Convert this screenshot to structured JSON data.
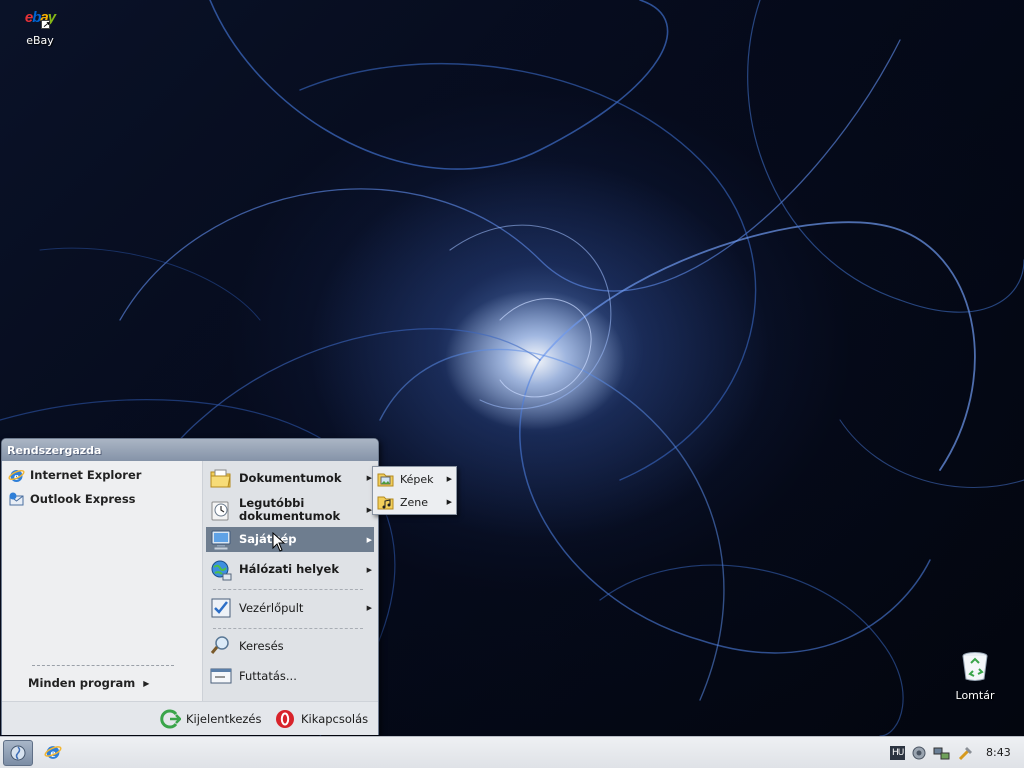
{
  "desktop": {
    "icons": [
      {
        "label": "eBay",
        "icon": "ebay-icon"
      },
      {
        "label": "Lomtár",
        "icon": "recycle-bin-icon"
      }
    ],
    "ebay_letters": [
      "e",
      "b",
      "a",
      "y"
    ]
  },
  "start_menu": {
    "user_name": "Rendszergazda",
    "pinned": [
      {
        "label": "Internet Explorer",
        "icon": "internet-explorer-icon"
      },
      {
        "label": "Outlook Express",
        "icon": "outlook-express-icon"
      }
    ],
    "all_programs_label": "Minden program",
    "right_items": [
      {
        "label": "Dokumentumok",
        "icon": "folder-documents-icon",
        "has_submenu": true
      },
      {
        "label": "Legutóbbi dokumentumok",
        "icon": "recent-documents-icon",
        "has_submenu": true
      },
      {
        "label": "Sajátgép",
        "icon": "my-computer-icon",
        "has_submenu": true,
        "highlighted": true
      },
      {
        "label": "Hálózati helyek",
        "icon": "network-places-icon",
        "has_submenu": true
      },
      {
        "label": "Vezérlőpult",
        "icon": "control-panel-icon",
        "has_submenu": true
      },
      {
        "label": "Keresés",
        "icon": "search-icon",
        "has_submenu": false
      },
      {
        "label": "Futtatás...",
        "icon": "run-icon",
        "has_submenu": false
      }
    ],
    "footer": {
      "logoff_label": "Kijelentkezés",
      "shutdown_label": "Kikapcsolás"
    }
  },
  "submenu": {
    "items": [
      {
        "label": "Képek",
        "icon": "pictures-folder-icon"
      },
      {
        "label": "Zene",
        "icon": "music-folder-icon"
      }
    ]
  },
  "taskbar": {
    "language": "HU",
    "clock": "8:43"
  },
  "colors": {
    "menu_highlight": "#6e7d8f",
    "menu_header": "#8593a8",
    "desktop_bg": "#03060f"
  }
}
